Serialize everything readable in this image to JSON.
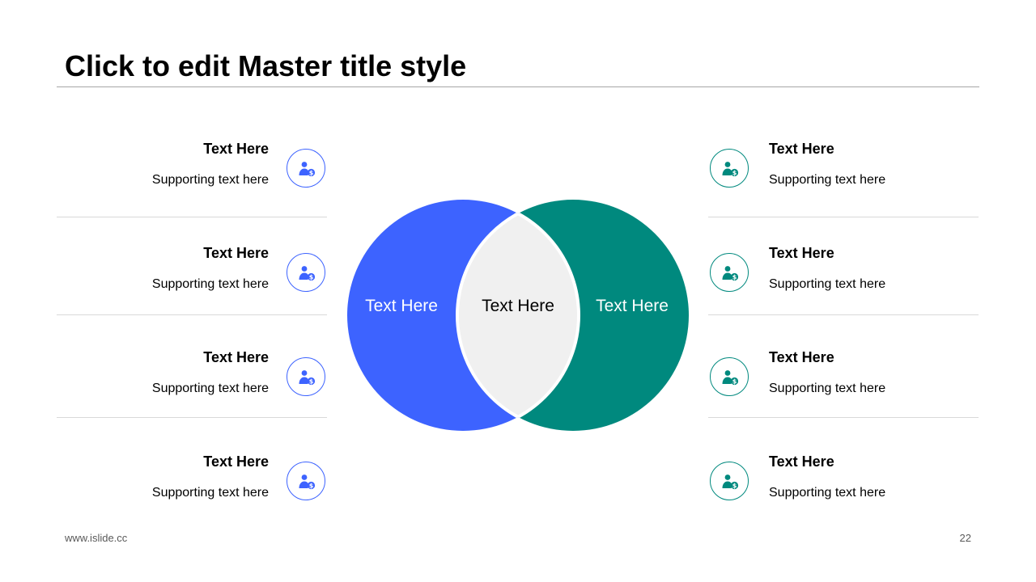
{
  "slide": {
    "title": "Click to edit Master title style",
    "footer_url": "www.islide.cc",
    "page_number": "22"
  },
  "colors": {
    "blue": "#3d63ff",
    "teal": "#00897e",
    "overlap": "#f0f0f0"
  },
  "venn": {
    "left_label": "Text Here",
    "center_label": "Text Here",
    "right_label": "Text Here"
  },
  "left_items": [
    {
      "heading": "Text Here",
      "text": "Supporting text here",
      "icon": "user-dollar-icon"
    },
    {
      "heading": "Text Here",
      "text": "Supporting text here",
      "icon": "user-dollar-icon"
    },
    {
      "heading": "Text Here",
      "text": "Supporting text here",
      "icon": "user-dollar-icon"
    },
    {
      "heading": "Text Here",
      "text": "Supporting text here",
      "icon": "user-dollar-icon"
    }
  ],
  "right_items": [
    {
      "heading": "Text Here",
      "text": "Supporting text here",
      "icon": "user-dollar-icon"
    },
    {
      "heading": "Text Here",
      "text": "Supporting text here",
      "icon": "user-dollar-icon"
    },
    {
      "heading": "Text Here",
      "text": "Supporting text here",
      "icon": "user-dollar-icon"
    },
    {
      "heading": "Text Here",
      "text": "Supporting text here",
      "icon": "user-dollar-icon"
    }
  ]
}
